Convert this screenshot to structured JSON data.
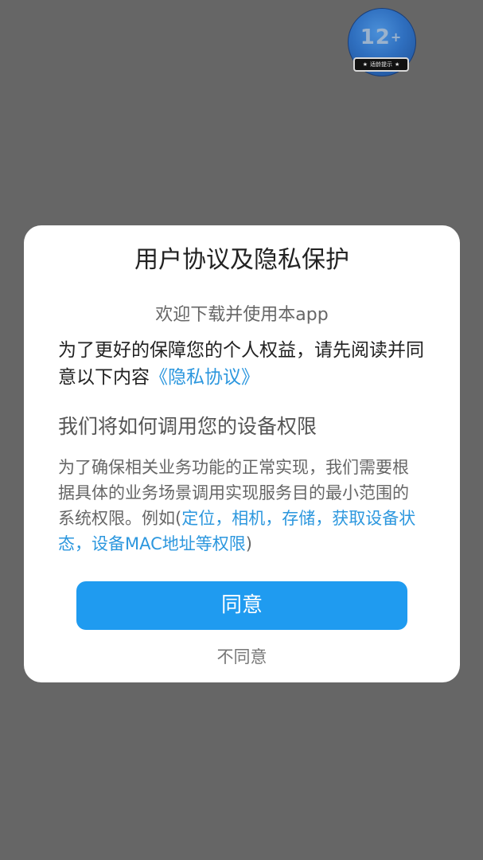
{
  "age_badge": {
    "number": "12",
    "plus": "+",
    "label": "适龄提示",
    "star": "★"
  },
  "dialog": {
    "title": "用户协议及隐私保护",
    "welcome": "欢迎下载并使用本app",
    "intro_text": "为了更好的保障您的个人权益，请先阅读并同意以下内容",
    "privacy_link": "《隐私协议》",
    "permission_heading": "我们将如何调用您的设备权限",
    "permission_body_prefix": "为了确保相关业务功能的正常实现，我们需要根据具体的业务场景调用实现服务目的最小范围的系统权限。例如(",
    "permission_examples": "定位，相机，存储，获取设备状态，设备MAC地址等权限",
    "permission_body_suffix": ")",
    "agree_label": "同意",
    "disagree_label": "不同意"
  },
  "colors": {
    "overlay": "#666666",
    "accent": "#1f9bf0",
    "link": "#2c97de"
  }
}
